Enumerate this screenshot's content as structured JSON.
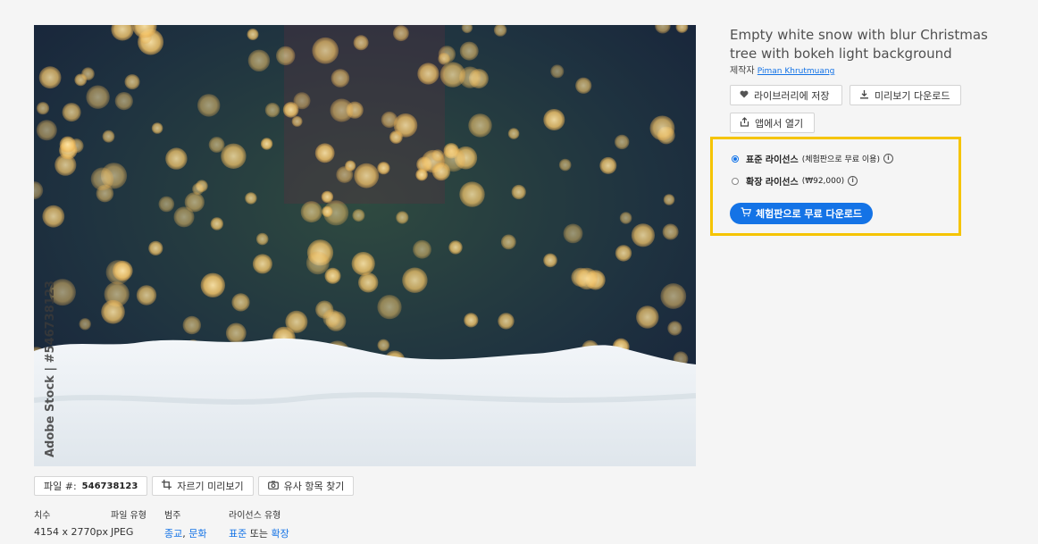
{
  "asset": {
    "title": "Empty white snow with blur Christmas tree with bokeh light background",
    "author_prefix": "제작자",
    "author_name": "Piman Khrutmuang",
    "watermark": "Adobe Stock | #546738123"
  },
  "actions": {
    "save_library": "라이브러리에 저장",
    "download_preview": "미리보기 다운로드",
    "open_in_app": "앱에서 열기"
  },
  "license": {
    "standard_label": "표준 라이선스",
    "standard_note": "(체험판으로 무료 이용)",
    "extended_label": "확장 라이선스",
    "extended_price": "(₩92,000)",
    "download_button": "체험판으로 무료 다운로드"
  },
  "toolbar": {
    "file_label": "파일 #:",
    "file_number": "546738123",
    "crop_preview": "자르기 미리보기",
    "find_similar": "유사 항목 찾기"
  },
  "meta": {
    "dimensions_label": "치수",
    "dimensions_value": "4154 x 2770px",
    "filetype_label": "파일 유형",
    "filetype_value": "JPEG",
    "category_label": "범주",
    "category_1": "종교",
    "category_2": "문화",
    "license_type_label": "라이선스 유형",
    "license_type_1": "표준",
    "license_type_or": "또는",
    "license_type_2": "확장"
  },
  "colors": {
    "accent": "#1473e6",
    "highlight": "#f5c400"
  }
}
